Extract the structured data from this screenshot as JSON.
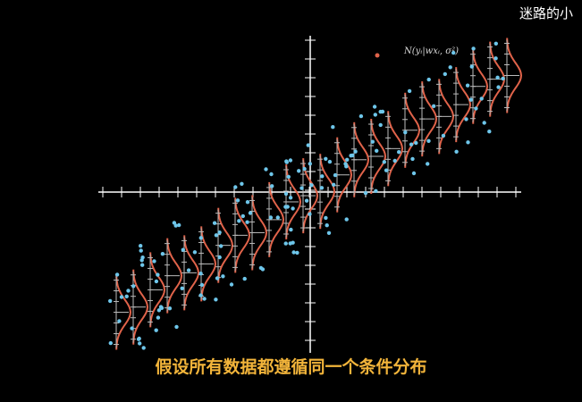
{
  "watermark": "迷路的小",
  "subtitle": "假设所有数据都遵循同一个条件分布",
  "formula": "N(yᵢ|wxᵢ, σ²)",
  "colors": {
    "background": "#000000",
    "axis": "#ffffff",
    "point": "#6ec6ea",
    "curve": "#e0634a",
    "subtitle": "#f2b43a"
  }
}
